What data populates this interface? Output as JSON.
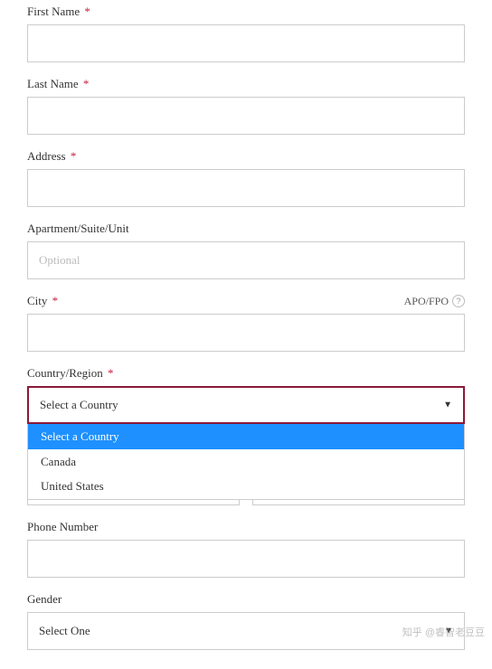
{
  "fields": {
    "firstName": {
      "label": "First Name",
      "required": true,
      "value": ""
    },
    "lastName": {
      "label": "Last Name",
      "required": true,
      "value": ""
    },
    "address": {
      "label": "Address",
      "required": true,
      "value": ""
    },
    "apartment": {
      "label": "Apartment/Suite/Unit",
      "required": false,
      "placeholder": "Optional",
      "value": ""
    },
    "city": {
      "label": "City",
      "required": true,
      "value": "",
      "apoFpoLabel": "APO/FPO"
    },
    "country": {
      "label": "Country/Region",
      "required": true,
      "selected": "Select a Country",
      "options": [
        "Select a Country",
        "Canada",
        "United States"
      ]
    },
    "phone": {
      "label": "Phone Number",
      "required": false,
      "value": ""
    },
    "gender": {
      "label": "Gender",
      "required": false,
      "selected": "Select One"
    }
  },
  "requiredMark": "*",
  "watermark": "知乎 @睿智老豆豆"
}
